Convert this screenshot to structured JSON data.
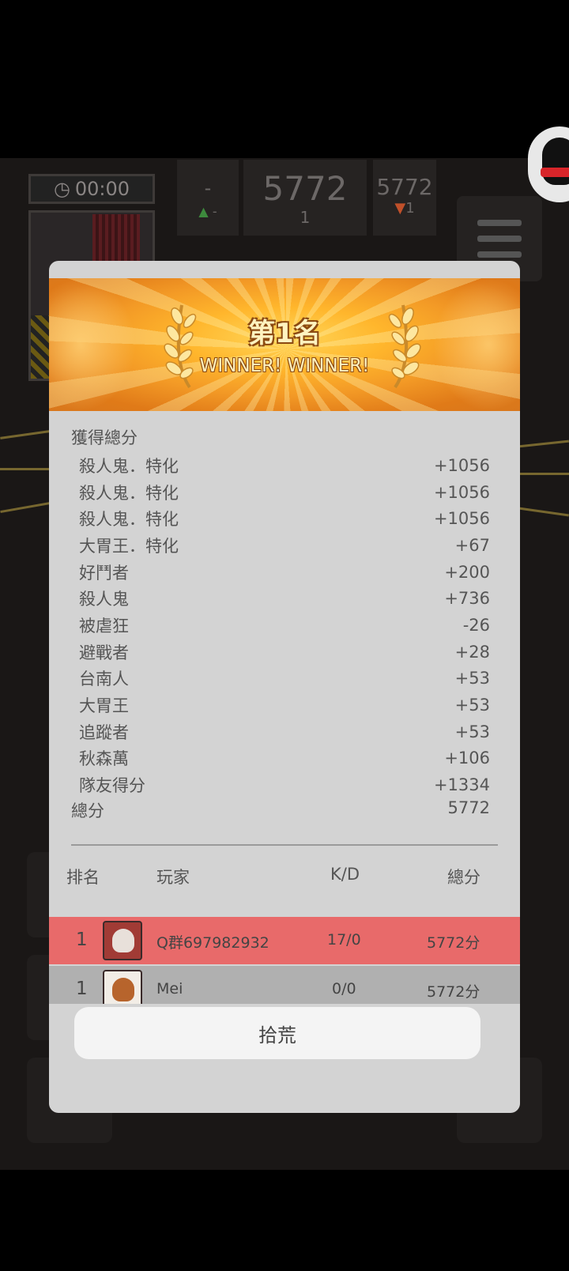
{
  "hud": {
    "timer": "00:00",
    "panel_left": {
      "top": "-",
      "bottom": "-"
    },
    "panel_center": {
      "score": "5772",
      "rank": "1"
    },
    "panel_right": {
      "score": "5772",
      "rank": "1"
    }
  },
  "result": {
    "rank_title": "第1名",
    "winner_text": "WINNER! WINNER!",
    "section_title": "獲得總分",
    "score_items": [
      {
        "label": "殺人鬼．特化",
        "value": "+1056"
      },
      {
        "label": "殺人鬼．特化",
        "value": "+1056"
      },
      {
        "label": "殺人鬼．特化",
        "value": "+1056"
      },
      {
        "label": "大胃王．特化",
        "value": "+67"
      },
      {
        "label": "好鬥者",
        "value": "+200"
      },
      {
        "label": "殺人鬼",
        "value": "+736"
      },
      {
        "label": "被虐狂",
        "value": "-26"
      },
      {
        "label": "避戰者",
        "value": "+28"
      },
      {
        "label": "台南人",
        "value": "+53"
      },
      {
        "label": "大胃王",
        "value": "+53"
      },
      {
        "label": "追蹤者",
        "value": "+53"
      },
      {
        "label": "秋森萬",
        "value": "+106"
      },
      {
        "label": "隊友得分",
        "value": "+1334"
      }
    ],
    "total_label": "總分",
    "total_value": "5772"
  },
  "leaderboard": {
    "headers": {
      "rank": "排名",
      "player": "玩家",
      "kd": "K/D",
      "score": "總分"
    },
    "rows": [
      {
        "rank": "1",
        "name": "Q群697982932",
        "kd": "17/0",
        "score": "5772分"
      },
      {
        "rank": "1",
        "name": "Mei",
        "kd": "0/0",
        "score": "5772分"
      }
    ]
  },
  "action_button": "拾荒",
  "colors": {
    "highlight_row": "#e86a6a",
    "banner": "#f39a26",
    "modal_bg": "#d3d3d3"
  }
}
